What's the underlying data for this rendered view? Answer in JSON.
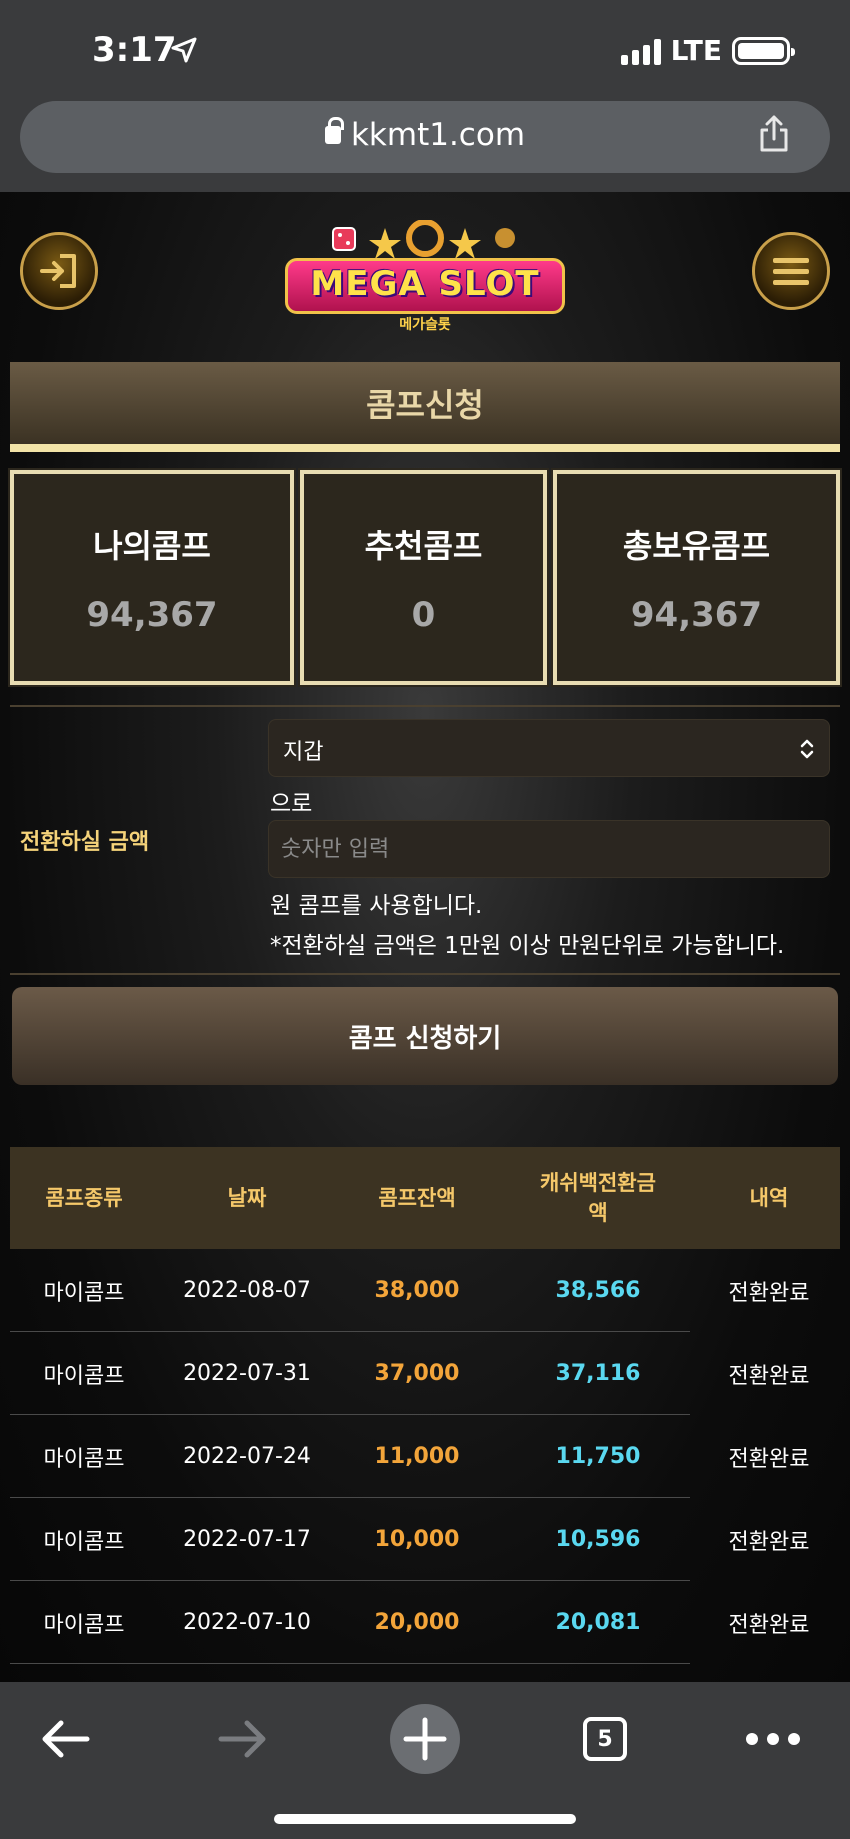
{
  "status_bar": {
    "time": "3:17",
    "network": "LTE"
  },
  "browser": {
    "url": "kkmt1.com",
    "tab_count": "5"
  },
  "logo": {
    "text": "MEGA SLOT",
    "sub_text": "메가슬롯"
  },
  "page_title": "콤프신청",
  "stats": [
    {
      "label": "나의콤프",
      "value": "94,367"
    },
    {
      "label": "추천콤프",
      "value": "0"
    },
    {
      "label": "총보유콤프",
      "value": "94,367"
    }
  ],
  "form": {
    "label": "전환하실 금액",
    "wallet_select_value": "지갑",
    "suffix_to": "으로",
    "amount_placeholder": "숫자만 입력",
    "use_text": "원 콤프를 사용합니다.",
    "note": "*전환하실 금액은 1만원 이상 만원단위로 가능합니다."
  },
  "apply_button": "콤프 신청하기",
  "table": {
    "headers": [
      "콤프종류",
      "날짜",
      "콤프잔액",
      "캐쉬백전환금\n액",
      "내역"
    ],
    "rows": [
      {
        "type": "마이콤프",
        "date": "2022-08-07",
        "balance": "38,000",
        "cashback": "38,566",
        "status": "전환완료"
      },
      {
        "type": "마이콤프",
        "date": "2022-07-31",
        "balance": "37,000",
        "cashback": "37,116",
        "status": "전환완료"
      },
      {
        "type": "마이콤프",
        "date": "2022-07-24",
        "balance": "11,000",
        "cashback": "11,750",
        "status": "전환완료"
      },
      {
        "type": "마이콤프",
        "date": "2022-07-17",
        "balance": "10,000",
        "cashback": "10,596",
        "status": "전환완료"
      },
      {
        "type": "마이콤프",
        "date": "2022-07-10",
        "balance": "20,000",
        "cashback": "20,081",
        "status": "전환완료"
      }
    ]
  },
  "colors": {
    "accent_gold": "#f5c86a",
    "balance_orange": "#f3a53a",
    "cashback_cyan": "#5ad8f0"
  }
}
